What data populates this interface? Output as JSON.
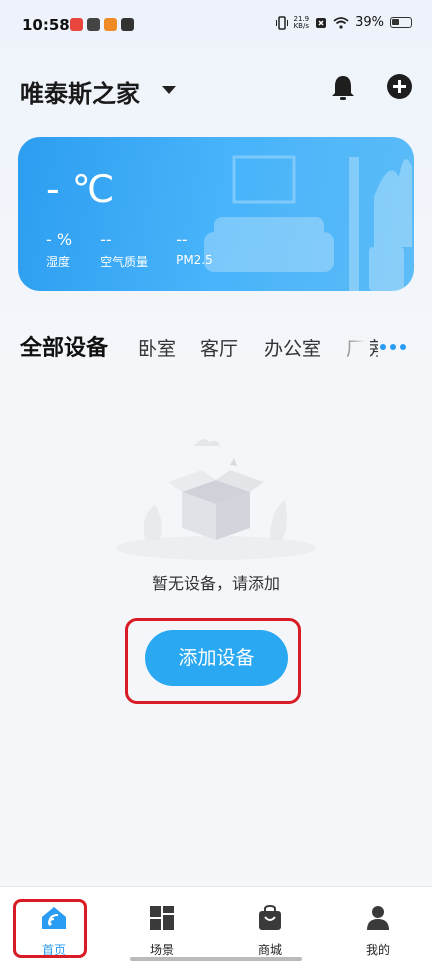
{
  "status_bar": {
    "time": "10:58",
    "net_speed_value": "21.9",
    "net_speed_unit": "KB/s",
    "battery_percent": "39%",
    "app_icon_colors": [
      "#e8453c",
      "#444444",
      "#f08a24",
      "#333333"
    ]
  },
  "header": {
    "home_name": "唯泰斯之家"
  },
  "weather": {
    "temperature": "- ℃",
    "metrics": [
      {
        "value": "- %",
        "label": "湿度"
      },
      {
        "value": "--",
        "label": "空气质量"
      },
      {
        "value": "--",
        "label": "PM2.5"
      }
    ]
  },
  "tabs": {
    "items": [
      "全部设备",
      "卧室",
      "客厅",
      "办公室",
      "厂房"
    ],
    "active_index": 0
  },
  "empty_state": {
    "message": "暂无设备，请添加",
    "add_button_label": "添加设备"
  },
  "bottom_nav": {
    "items": [
      {
        "label": "首页",
        "icon": "home-icon",
        "active": true
      },
      {
        "label": "场景",
        "icon": "grid-icon",
        "active": false
      },
      {
        "label": "商城",
        "icon": "shopping-bag-icon",
        "active": false
      },
      {
        "label": "我的",
        "icon": "person-icon",
        "active": false
      }
    ]
  },
  "colors": {
    "accent": "#2aa8f2",
    "highlight": "#d81b24"
  }
}
